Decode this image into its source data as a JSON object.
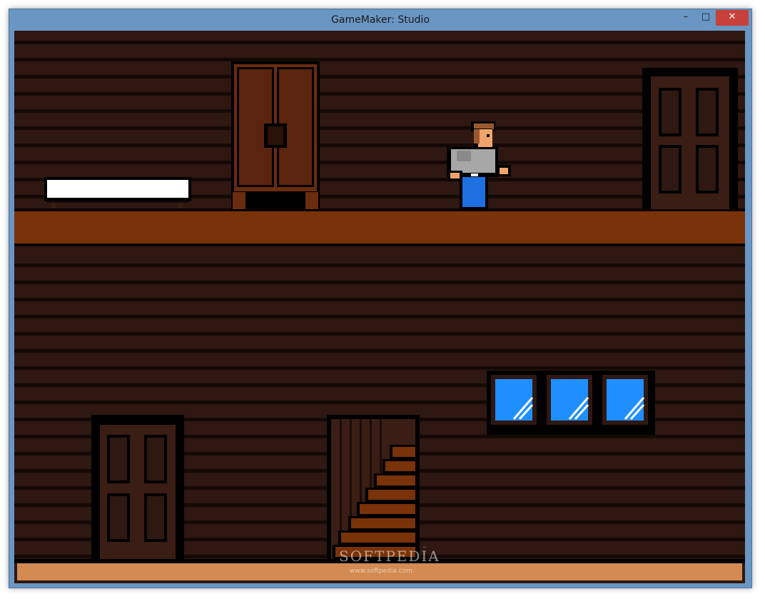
{
  "window": {
    "title": "GameMaker: Studio",
    "controls": {
      "minimize": "–",
      "maximize": "□",
      "close": "✕"
    }
  },
  "colors": {
    "wall": "#2f1812",
    "plank_line": "#150906",
    "upper_floor": "#7a3209",
    "bottom_floor": "#d38b52",
    "furniture": "#5b240e",
    "door": "#3a1d14",
    "window_glass": "#1f8fff",
    "bed_sheet": "#ffffff"
  },
  "scene": {
    "objects": [
      "bed",
      "wardrobe",
      "player-character",
      "door",
      "window",
      "door",
      "staircase"
    ]
  },
  "watermark": {
    "brand": "SOFTPEDIA",
    "trademark": "™",
    "url": "www.softpedia.com"
  }
}
